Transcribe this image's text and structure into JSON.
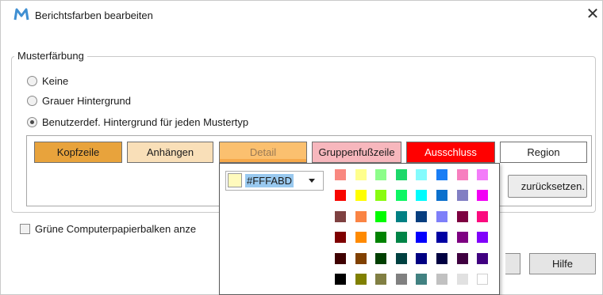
{
  "window": {
    "title": "Berichtsfarben bearbeiten",
    "close_glyph": "✕"
  },
  "group": {
    "legend": "Musterfärbung",
    "options": [
      {
        "label": "Keine",
        "checked": false
      },
      {
        "label": "Grauer Hintergrund",
        "checked": false
      },
      {
        "label": "Benutzerdef. Hintergrund für jeden Mustertyp",
        "checked": true
      }
    ]
  },
  "types": [
    {
      "label": "Kopfzeile",
      "bg": "#e8a33c",
      "border": "#707070"
    },
    {
      "label": "Anhängen",
      "bg": "#f9dfb8",
      "border": "#707070"
    },
    {
      "label": "Detail",
      "bg": "#fbc06f",
      "border": "#707070"
    },
    {
      "label": "Gruppenfußzeile",
      "bg": "#f7b7bd",
      "border": "#707070"
    },
    {
      "label": "Ausschluss",
      "bg": "#ff0000",
      "border": "#707070",
      "text_color": "#ffffff"
    },
    {
      "label": "Region",
      "bg": "#ffffff",
      "border": "#707070"
    }
  ],
  "reset_label": "zurücksetzen.",
  "green_bars_label": "Grüne Computerpapierbalken anze",
  "help_label": "Hilfe",
  "color_picker": {
    "hex_value": "#FFFABD",
    "current_color": "#fffabd",
    "palette": [
      [
        "#f98880",
        "#ffff8d",
        "#8dfd8a",
        "#1cd86a",
        "#83fbfd",
        "#1a7ef5",
        "#f77fbf",
        "#f37cf9"
      ],
      [
        "#f80600",
        "#fffe00",
        "#89fb10",
        "#0df663",
        "#00fcfd",
        "#0b70cd",
        "#827fc3",
        "#f200f5"
      ],
      [
        "#7e4141",
        "#fa8444",
        "#00fc01",
        "#008083",
        "#073e7f",
        "#7e7ff9",
        "#7d0040",
        "#fb0b7e"
      ],
      [
        "#7e0000",
        "#ff8a00",
        "#008200",
        "#008446",
        "#0300fd",
        "#0000a2",
        "#7d0081",
        "#8001fb"
      ],
      [
        "#3f0000",
        "#804000",
        "#003f00",
        "#004040",
        "#000082",
        "#000041",
        "#3f0040",
        "#400080"
      ],
      [
        "#000000",
        "#808000",
        "#817f43",
        "#808080",
        "#418181",
        "#c1c1c1",
        "#e1e1e1",
        "#ffffff"
      ]
    ]
  }
}
